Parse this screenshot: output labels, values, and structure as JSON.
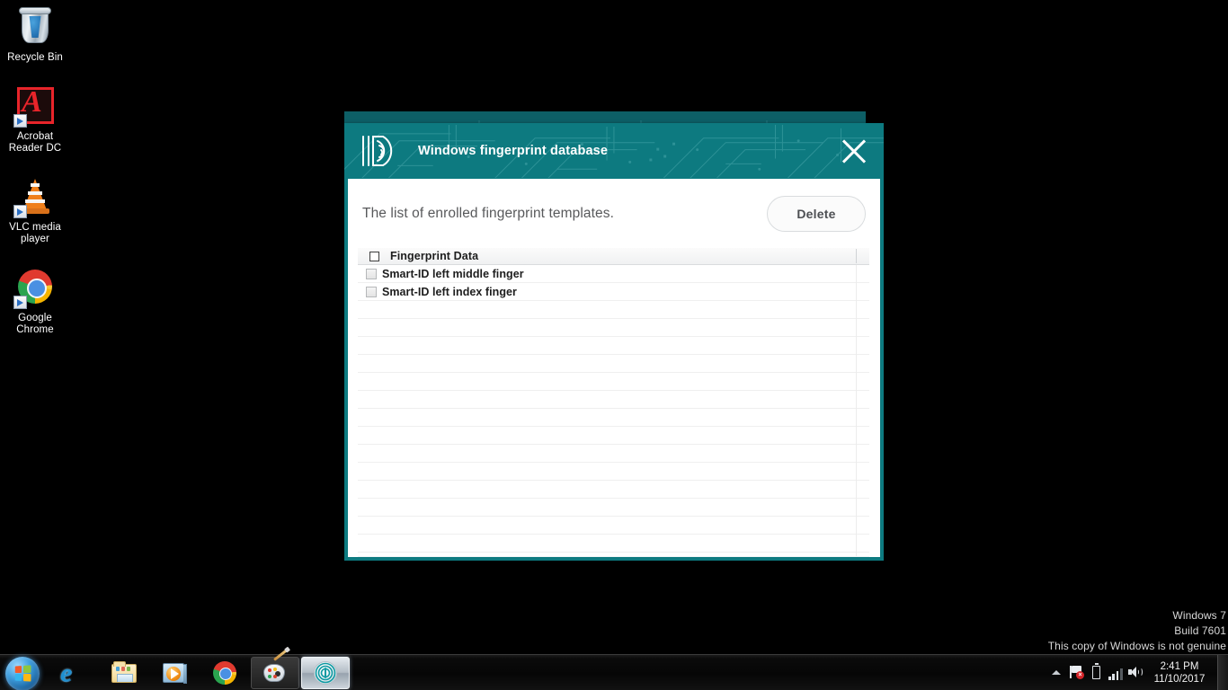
{
  "desktop": {
    "icons": [
      {
        "name": "recycle-bin",
        "label": "Recycle Bin",
        "icon": "recycle-bin-icon"
      },
      {
        "name": "acrobat",
        "label": "Acrobat\nReader DC",
        "label_l1": "Acrobat",
        "label_l2": "Reader DC",
        "icon": "acrobat-reader-icon"
      },
      {
        "name": "vlc",
        "label": "VLC media\nplayer",
        "label_l1": "VLC media",
        "label_l2": "player",
        "icon": "vlc-cone-icon"
      },
      {
        "name": "chrome",
        "label": "Google\nChrome",
        "label_l1": "Google",
        "label_l2": "Chrome",
        "icon": "google-chrome-icon"
      }
    ],
    "watermark": {
      "line1": "Windows 7",
      "line2": "Build 7601",
      "line3": "This copy of Windows is not genuine"
    },
    "background_color": "#000000"
  },
  "back_window": {
    "close_label": "x",
    "header_color": "#0d5f66"
  },
  "window": {
    "title": "Windows fingerprint database",
    "logo_icon": "fingerprint-id-logo-icon",
    "close_icon": "close-icon",
    "header_color": "#0d7a80",
    "border_color": "#0d7a80",
    "body": {
      "subtitle": "The list of enrolled fingerprint templates.",
      "delete_label": "Delete"
    },
    "list": {
      "select_all_checked": false,
      "columns": [
        "Fingerprint Data"
      ],
      "rows": [
        {
          "label": "Smart-ID left middle finger",
          "checked": false
        },
        {
          "label": "Smart-ID left index finger",
          "checked": false
        }
      ],
      "empty_row_count": 14
    }
  },
  "taskbar": {
    "start_label": "Start",
    "start_icon": "windows-start-orb-icon",
    "items": [
      {
        "name": "internet-explorer",
        "icon": "internet-explorer-icon",
        "label": "Internet Explorer",
        "state": "pinned"
      },
      {
        "name": "windows-explorer",
        "icon": "folder-icon",
        "label": "Windows Explorer",
        "state": "pinned"
      },
      {
        "name": "media-player",
        "icon": "media-player-icon",
        "label": "Windows Media Player",
        "state": "pinned"
      },
      {
        "name": "google-chrome",
        "icon": "google-chrome-icon",
        "label": "Google Chrome",
        "state": "pinned"
      },
      {
        "name": "paint",
        "icon": "paint-palette-icon",
        "label": "Paint",
        "state": "running"
      },
      {
        "name": "fingerprint-app",
        "icon": "fingerprint-icon",
        "label": "Windows fingerprint database",
        "state": "active"
      }
    ],
    "tray": {
      "show_hidden_icon": "chevron-up-icon",
      "action_center_icon": "flag-alert-icon",
      "battery_icon": "battery-icon",
      "network_icon": "signal-bars-icon",
      "volume_icon": "speaker-icon",
      "clock_time": "2:41 PM",
      "clock_date": "11/10/2017",
      "show_desktop_label": "Show desktop"
    }
  }
}
